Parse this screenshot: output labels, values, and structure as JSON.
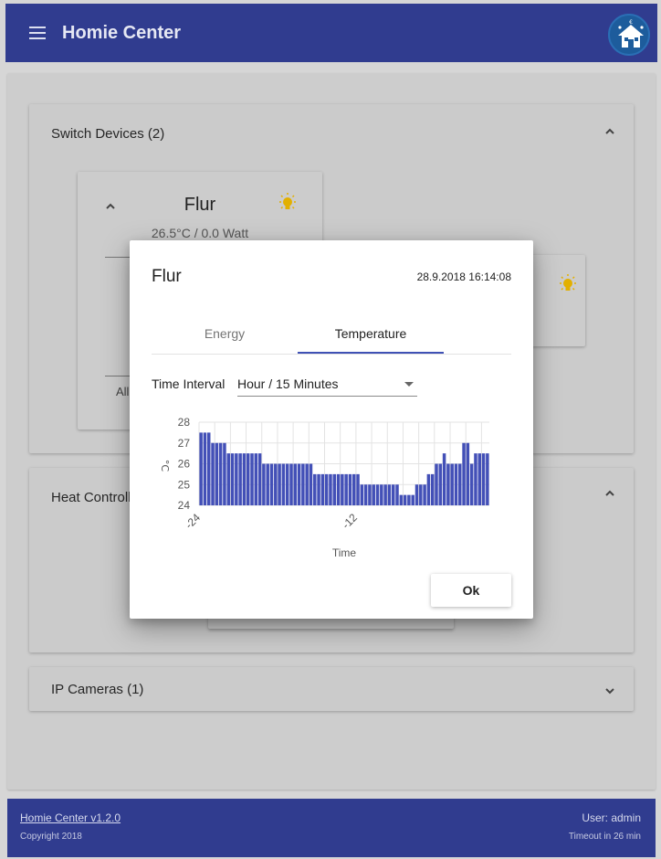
{
  "app": {
    "title": "Homie Center"
  },
  "panels": {
    "switch_devices": "Switch Devices (2)",
    "heat_control": "Heat Controll",
    "ip_cameras": "IP Cameras (1)"
  },
  "device_card": {
    "name": "Flur",
    "status": "26.5°C / 0.0 Watt",
    "partial_label": "All"
  },
  "footer": {
    "version": "Homie Center v1.2.0",
    "copyright": "Copyright 2018",
    "user": "User: admin",
    "timeout": "Timeout in 26 min"
  },
  "dialog": {
    "title": "Flur",
    "timestamp": "28.9.2018 16:14:08",
    "tabs": [
      "Energy",
      "Temperature"
    ],
    "active_tab": 1,
    "time_interval_label": "Time Interval",
    "time_interval_value": "Hour / 15 Minutes",
    "ok_label": "Ok"
  },
  "colors": {
    "primary": "#303c8f",
    "bar": "#4350b7",
    "bulb": "#e2b000"
  },
  "chart_data": {
    "type": "bar",
    "xlabel": "Time",
    "ylabel": "°C",
    "ylim": [
      24,
      28
    ],
    "yticks": [
      24,
      25,
      26,
      27,
      28
    ],
    "xtick_labels": [
      {
        "index": 0,
        "label": "-24"
      },
      {
        "index": 40,
        "label": "-12"
      }
    ],
    "grid": true,
    "values": [
      27.5,
      27.5,
      27.5,
      27,
      27,
      27,
      27,
      26.5,
      26.5,
      26.5,
      26.5,
      26.5,
      26.5,
      26.5,
      26.5,
      26.5,
      26,
      26,
      26,
      26,
      26,
      26,
      26,
      26,
      26,
      26,
      26,
      26,
      26,
      25.5,
      25.5,
      25.5,
      25.5,
      25.5,
      25.5,
      25.5,
      25.5,
      25.5,
      25.5,
      25.5,
      25.5,
      25,
      25,
      25,
      25,
      25,
      25,
      25,
      25,
      25,
      25,
      24.5,
      24.5,
      24.5,
      24.5,
      25,
      25,
      25,
      25.5,
      25.5,
      26,
      26,
      26.5,
      26,
      26,
      26,
      26,
      27,
      27,
      26,
      26.5,
      26.5,
      26.5,
      26.5
    ]
  }
}
